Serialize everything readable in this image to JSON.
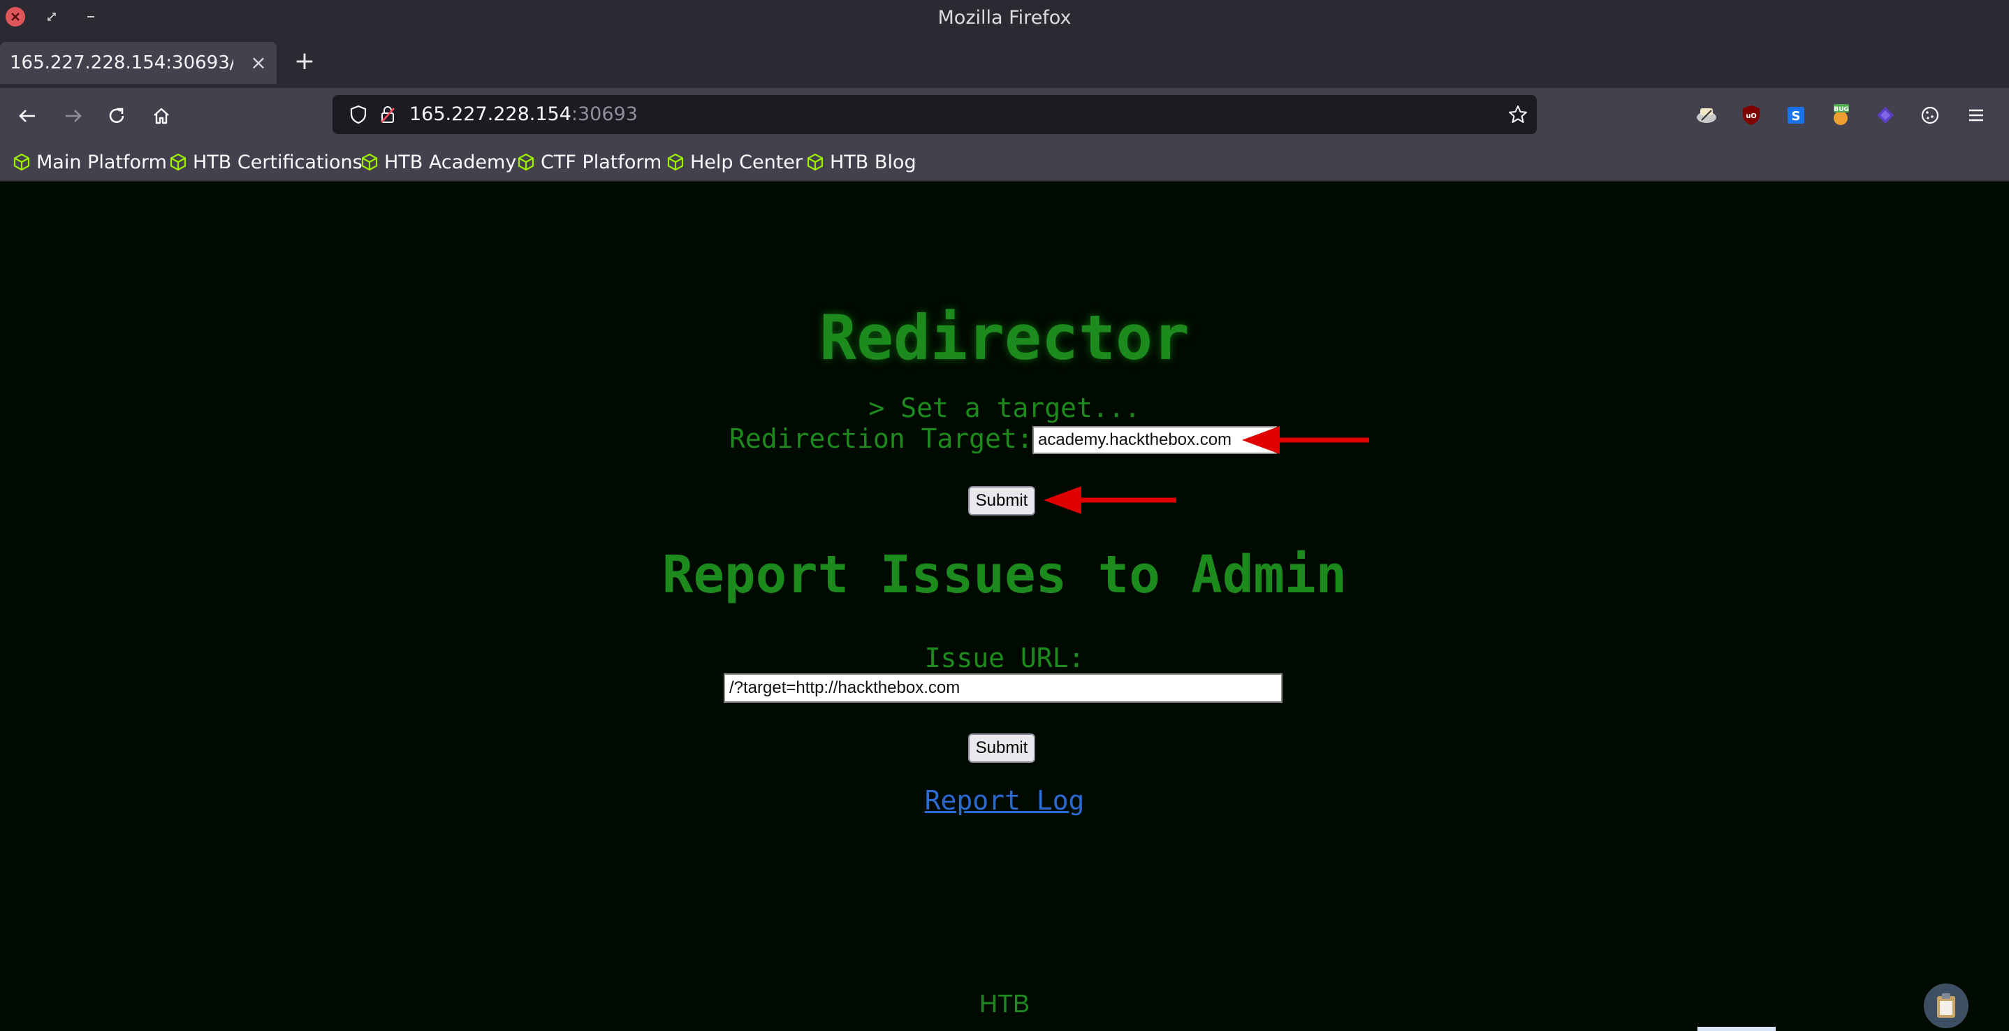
{
  "window": {
    "title": "Mozilla Firefox"
  },
  "tab": {
    "title": "165.227.228.154:30693/",
    "close_glyph": "×",
    "new_tab_glyph": "+"
  },
  "urlbar": {
    "host": "165.227.228.154",
    "port": ":30693"
  },
  "bookmarks": [
    {
      "label": "Main Platform"
    },
    {
      "label": "HTB Certifications"
    },
    {
      "label": "HTB Academy"
    },
    {
      "label": "CTF Platform"
    },
    {
      "label": "Help Center"
    },
    {
      "label": "HTB Blog"
    }
  ],
  "page": {
    "heading": "Redirector",
    "prompt": "> Set a target...",
    "redirect_label": "Redirection Target:",
    "redirect_value": "academy.hackthebox.com",
    "redirect_submit": "Submit",
    "report_heading": "Report Issues to Admin",
    "issue_label": "Issue URL:",
    "issue_value": "/?target=http://hackthebox.com",
    "issue_submit": "Submit",
    "report_log_link": "Report Log",
    "footer": "HTB"
  },
  "colors": {
    "page_bg": "#000a00",
    "terminal_green": "#1c8a1c",
    "link_blue": "#2a6ad1",
    "annotation_red": "#e00000",
    "bookmark_icon": "#9fef00"
  },
  "icons": [
    "close-icon",
    "restore-icon",
    "minimize-icon",
    "back-icon",
    "forward-icon",
    "reload-icon",
    "home-icon",
    "shield-icon",
    "lock-icon",
    "star-icon",
    "menu-icon"
  ]
}
